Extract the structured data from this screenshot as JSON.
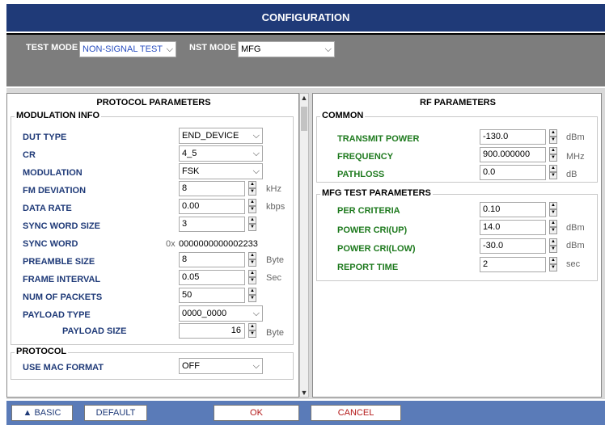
{
  "title": "CONFIGURATION",
  "modes": {
    "test_mode_label": "TEST MODE",
    "test_mode_value": "NON-SIGNAL TEST",
    "nst_mode_label": "NST MODE",
    "nst_mode_value": "MFG"
  },
  "protocol_params": {
    "header": "PROTOCOL PARAMETERS",
    "modulation_group": "MODULATION INFO",
    "rows": {
      "dut_type": {
        "label": "DUT TYPE",
        "value": "END_DEVICE"
      },
      "cr": {
        "label": "CR",
        "value": "4_5"
      },
      "modulation": {
        "label": "MODULATION",
        "value": "FSK"
      },
      "fm_deviation": {
        "label": "FM DEVIATION",
        "value": "8",
        "unit": "kHz"
      },
      "data_rate": {
        "label": "DATA RATE",
        "value": "0.00",
        "unit": "kbps"
      },
      "sync_word_size": {
        "label": "SYNC WORD SIZE",
        "value": "3"
      },
      "sync_word": {
        "label": "SYNC WORD",
        "prefix": "0x",
        "value": "0000000000002233"
      },
      "preamble_size": {
        "label": "PREAMBLE SIZE",
        "value": "8",
        "unit": "Byte"
      },
      "frame_interval": {
        "label": "FRAME INTERVAL",
        "value": "0.05",
        "unit": "Sec"
      },
      "num_packets": {
        "label": "NUM OF PACKETS",
        "value": "50"
      },
      "payload_type": {
        "label": "PAYLOAD TYPE",
        "value": "0000_0000"
      },
      "payload_size": {
        "label": "PAYLOAD SIZE",
        "value": "16",
        "unit": "Byte"
      }
    },
    "protocol_group": "PROTOCOL",
    "use_mac_format": {
      "label": "USE MAC FORMAT",
      "value": "OFF"
    }
  },
  "rf_params": {
    "header": "RF PARAMETERS",
    "common_group": "COMMON",
    "transmit_power": {
      "label": "TRANSMIT POWER",
      "value": "-130.0",
      "unit": "dBm"
    },
    "frequency": {
      "label": "FREQUENCY",
      "value": "900.000000",
      "unit": "MHz"
    },
    "pathloss": {
      "label": "PATHLOSS",
      "value": "0.0",
      "unit": "dB"
    },
    "mfg_group": "MFG TEST PARAMETERS",
    "per_criteria": {
      "label": "PER CRITERIA",
      "value": "0.10"
    },
    "power_cri_up": {
      "label": "POWER CRI(UP)",
      "value": "14.0",
      "unit": "dBm"
    },
    "power_cri_low": {
      "label": "POWER CRI(LOW)",
      "value": "-30.0",
      "unit": "dBm"
    },
    "report_time": {
      "label": "REPORT TIME",
      "value": "2",
      "unit": "sec"
    }
  },
  "buttons": {
    "basic": "▲ BASIC",
    "default": "DEFAULT",
    "ok": "OK",
    "cancel": "CANCEL"
  }
}
